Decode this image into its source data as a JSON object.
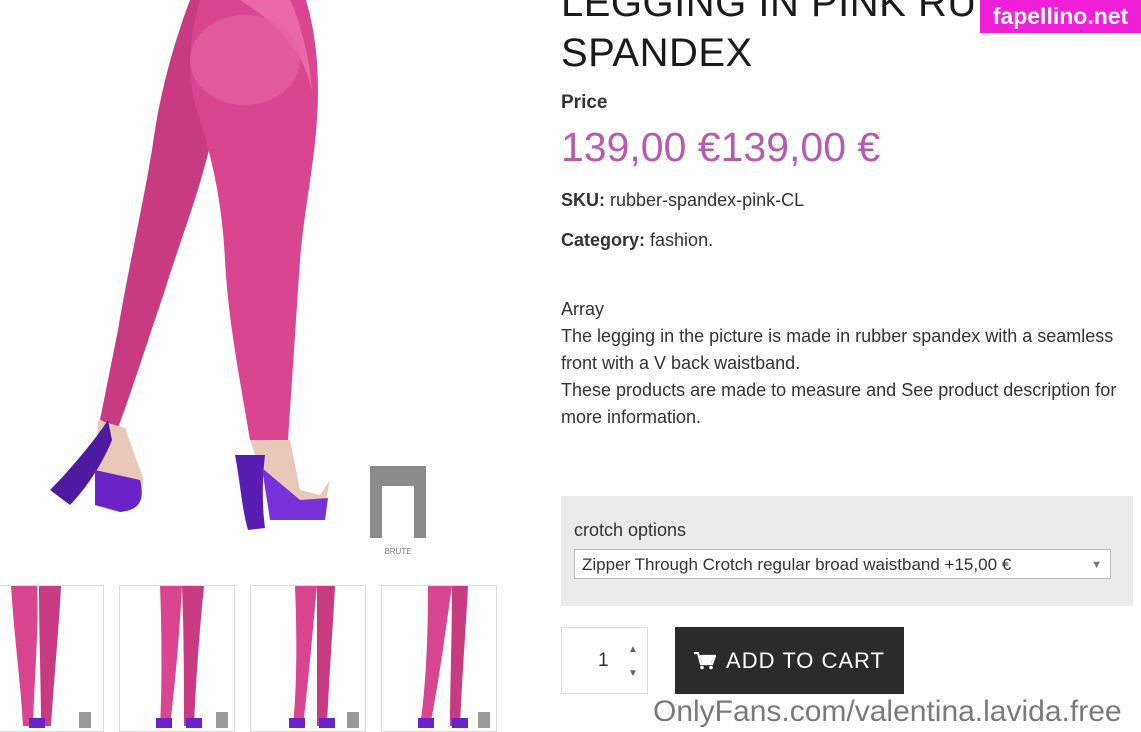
{
  "product": {
    "title": "LEGGING IN PINK RUBBER SPANDEX",
    "title_line1": "LEGGING IN PINK RUB",
    "title_line2": "SPANDEX",
    "price_label": "Price",
    "price": "139,00 €139,00 €",
    "sku_label": "SKU:",
    "sku": "rubber-spandex-pink-CL",
    "category_label": "Category:",
    "category": "fashion.",
    "description": [
      "Array",
      "The legging in the picture is made in rubber spandex with a seamless front with a V back waistband.",
      "These products are made to measure and See product description for more information."
    ]
  },
  "options": {
    "label": "crotch options",
    "selected": "Zipper Through Crotch regular broad waistband +15,00 €"
  },
  "cart": {
    "quantity": "1",
    "add_label": "ADD TO CART"
  },
  "gallery": {
    "logo_text": "BRUTE",
    "thumbnail_count": 4
  },
  "watermarks": {
    "top": "fapellino.net",
    "bottom": "OnlyFans.com/valentina.lavida.free"
  },
  "colors": {
    "price": "#b45cae",
    "button_bg": "#2b2b2b",
    "leggings": "#d9468f",
    "heels": "#6b22c8",
    "watermark_bg": "#f020d8"
  },
  "icons": {
    "cart": "cart-icon",
    "qty_up": "chevron-up-icon",
    "qty_down": "chevron-down-icon",
    "select_arrow": "triangle-down-icon"
  }
}
